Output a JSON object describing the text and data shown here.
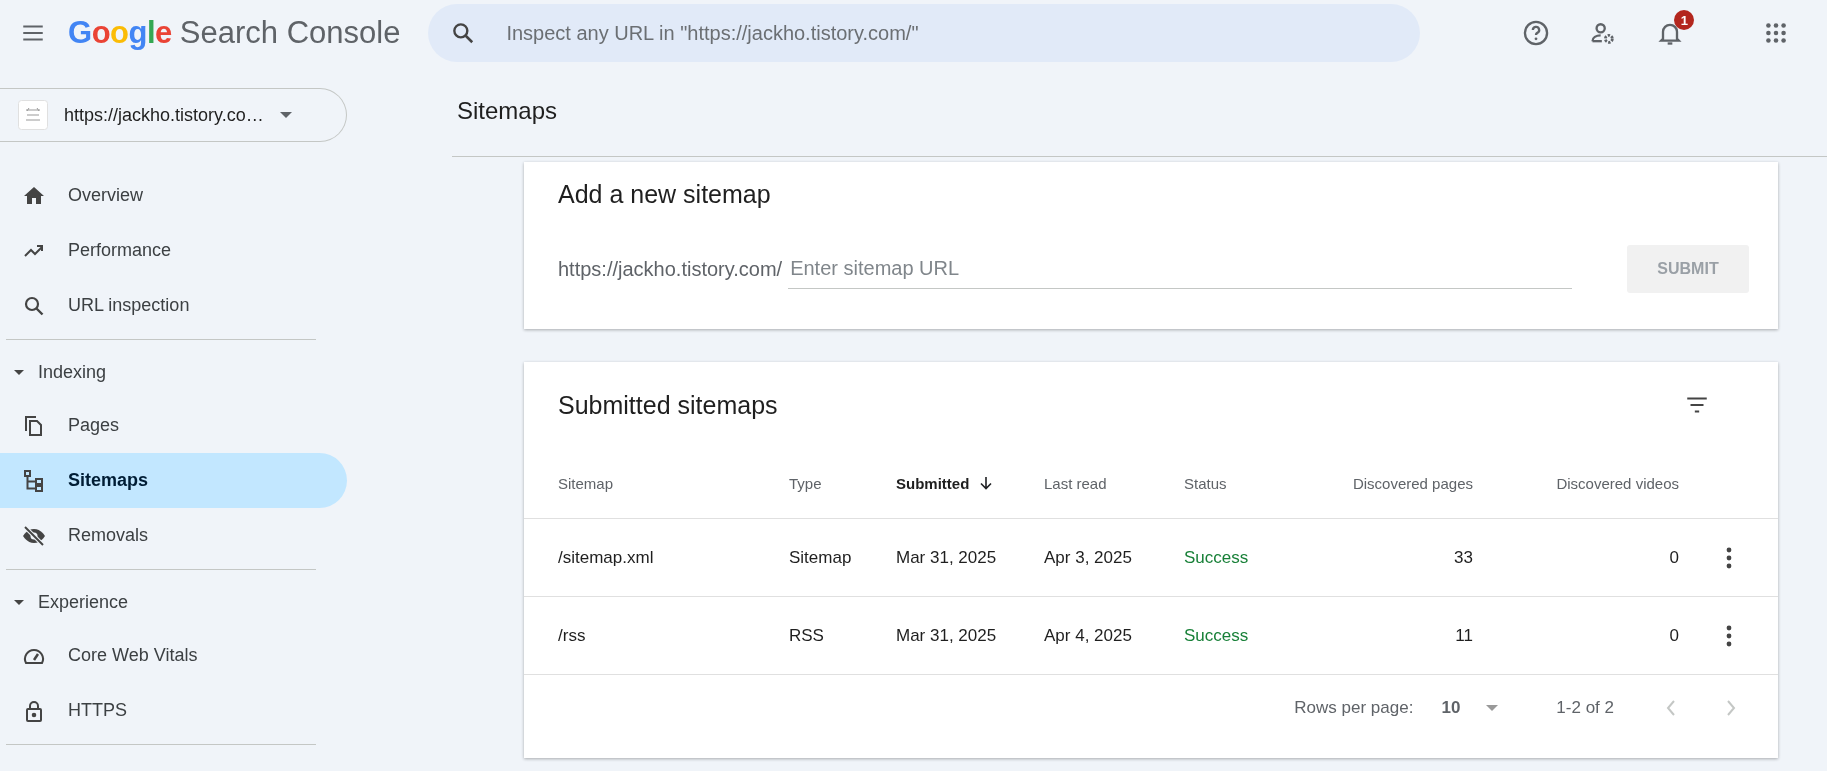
{
  "header": {
    "logo": {
      "brand": "Google",
      "product": "Search Console"
    },
    "search": {
      "placeholder": "Inspect any URL in \"https://jackho.tistory.com/\""
    },
    "notifications": {
      "count": "1"
    }
  },
  "sidebar": {
    "property": {
      "url": "https://jackho.tistory.co…"
    },
    "items": [
      {
        "label": "Overview",
        "kind": "home",
        "selected": false
      },
      {
        "label": "Performance",
        "kind": "trend",
        "selected": false
      },
      {
        "label": "URL inspection",
        "kind": "search",
        "selected": false
      }
    ],
    "sections": [
      {
        "title": "Indexing",
        "expanded": true,
        "items": [
          {
            "label": "Pages",
            "kind": "pages",
            "selected": false
          },
          {
            "label": "Sitemaps",
            "kind": "sitemap",
            "selected": true
          },
          {
            "label": "Removals",
            "kind": "eyeoff",
            "selected": false
          }
        ]
      },
      {
        "title": "Experience",
        "expanded": true,
        "items": [
          {
            "label": "Core Web Vitals",
            "kind": "gauge",
            "selected": false
          },
          {
            "label": "HTTPS",
            "kind": "lock",
            "selected": false
          }
        ]
      }
    ]
  },
  "page_title": "Sitemaps",
  "add_sitemap": {
    "title": "Add a new sitemap",
    "prefix": "https://jackho.tistory.com/",
    "placeholder": "Enter sitemap URL",
    "button": {
      "label": "SUBMIT",
      "disabled": true
    }
  },
  "submitted": {
    "title": "Submitted sitemaps",
    "columns": [
      {
        "label": "Sitemap",
        "sorted": false
      },
      {
        "label": "Type",
        "sorted": false
      },
      {
        "label": "Submitted",
        "sorted": true
      },
      {
        "label": "Last read",
        "sorted": false
      },
      {
        "label": "Status",
        "sorted": false
      },
      {
        "label": "Discovered pages",
        "sorted": false
      },
      {
        "label": "Discovered videos",
        "sorted": false
      }
    ],
    "rows": [
      [
        "/sitemap.xml",
        "Sitemap",
        "Mar 31, 2025",
        "Apr 3, 2025",
        "Success",
        "33",
        "0"
      ],
      [
        "/rss",
        "RSS",
        "Mar 31, 2025",
        "Apr 4, 2025",
        "Success",
        "11",
        "0"
      ]
    ],
    "footer": {
      "rows_per_page_label": "Rows per page:",
      "rows_per_page": "10",
      "range": "1-2 of 2"
    }
  }
}
